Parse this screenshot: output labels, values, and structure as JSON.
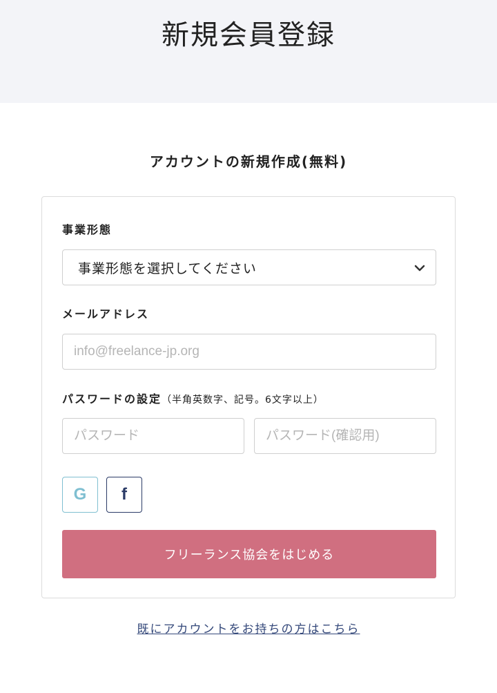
{
  "page": {
    "title": "新規会員登録",
    "subtitle": "アカウントの新規作成(無料)"
  },
  "form": {
    "business_type": {
      "label": "事業形態",
      "selected": "事業形態を選択してください"
    },
    "email": {
      "label": "メールアドレス",
      "placeholder": "info@freelance-jp.org"
    },
    "password": {
      "label": "パスワードの設定",
      "note": "（半角英数字、記号。6文字以上）",
      "placeholder": "パスワード",
      "confirm_placeholder": "パスワード(確認用)"
    },
    "social": {
      "google_glyph": "G",
      "facebook_glyph": "f"
    },
    "submit_label": "フリーランス協会をはじめる"
  },
  "footer": {
    "login_link": "既にアカウントをお持ちの方はこちら"
  },
  "colors": {
    "hero_bg": "#f3f4f8",
    "submit_bg": "#d06f80",
    "google": "#7fbfd1",
    "facebook": "#2a3a66",
    "link": "#34487a"
  },
  "icons": [
    "chevron-down-icon",
    "google-icon",
    "facebook-icon"
  ]
}
